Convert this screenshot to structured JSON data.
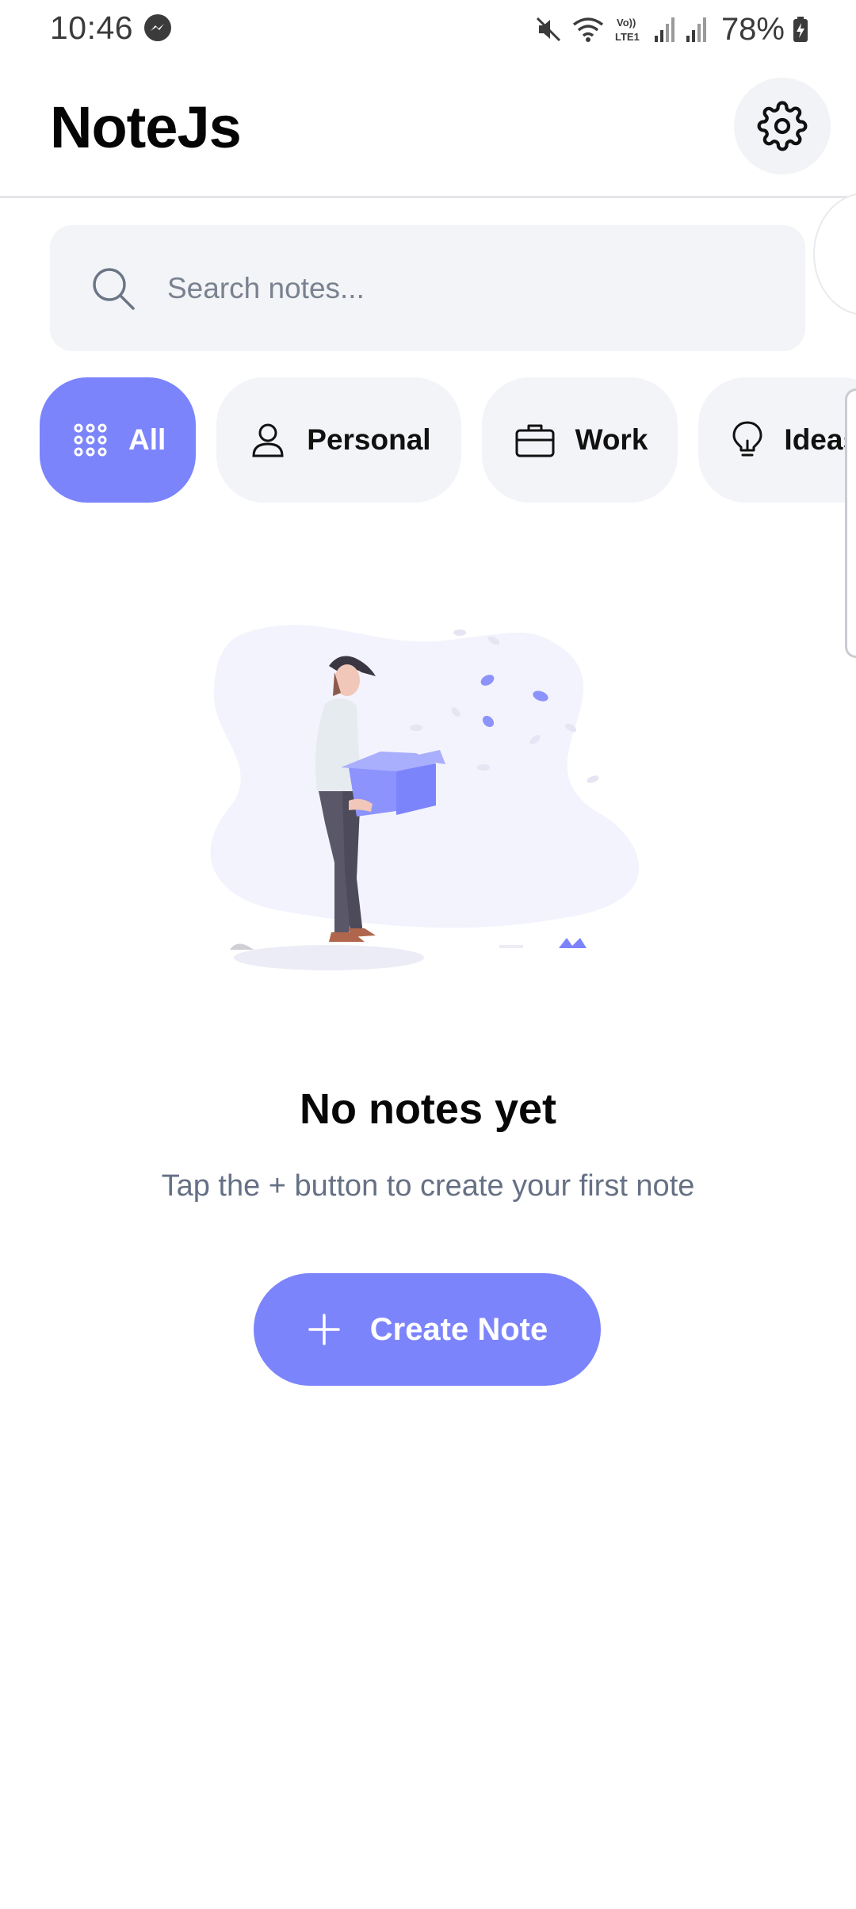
{
  "status_bar": {
    "time": "10:46",
    "battery": "78%",
    "icons": [
      "messenger-icon",
      "mute-icon",
      "wifi-icon",
      "volte-icon",
      "signal-icon",
      "signal-icon",
      "battery-charging-icon"
    ]
  },
  "header": {
    "title": "NoteJs",
    "settings_icon": "gear-icon"
  },
  "search": {
    "placeholder": "Search notes...",
    "value": "",
    "icon": "search-icon"
  },
  "categories": [
    {
      "label": "All",
      "icon": "grid-dots-icon",
      "active": true
    },
    {
      "label": "Personal",
      "icon": "person-icon",
      "active": false
    },
    {
      "label": "Work",
      "icon": "briefcase-icon",
      "active": false
    },
    {
      "label": "Ideas",
      "icon": "lightbulb-icon",
      "active": false
    }
  ],
  "empty_state": {
    "illustration": "person-holding-box-illustration",
    "title": "No notes yet",
    "subtitle": "Tap the + button to create your first note",
    "button_label": "Create Note",
    "button_icon": "plus-icon"
  },
  "colors": {
    "accent": "#7c84fc",
    "chip_bg": "#f2f4f7",
    "muted_text": "#667085",
    "text": "#070707"
  }
}
